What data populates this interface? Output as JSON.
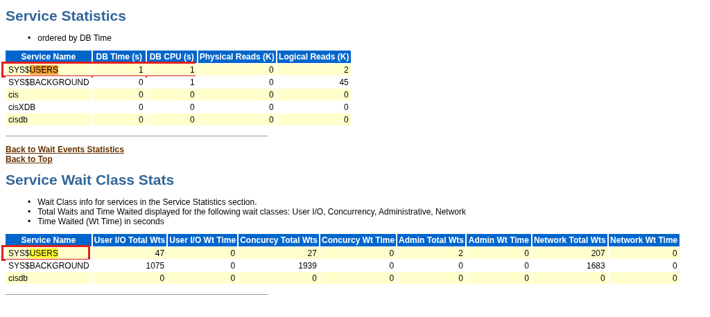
{
  "sections": [
    {
      "title": "Service Statistics",
      "notes": [
        {
          "bullet": "•",
          "text": "ordered by DB Time"
        }
      ],
      "table": {
        "columns": [
          "Service Name",
          "DB Time (s)",
          "DB CPU (s)",
          "Physical Reads (K)",
          "Logical Reads (K)"
        ],
        "rows": [
          {
            "service": {
              "prefix": "SYS$",
              "highlight": "USERS",
              "color": "#f4a131",
              "boxed": true
            },
            "values": [
              {
                "text": "1",
                "boxed": true
              },
              {
                "text": "1",
                "boxed": true
              },
              {
                "text": "0",
                "boxed": false
              },
              {
                "text": "2",
                "boxed": false
              }
            ]
          },
          {
            "service": {
              "prefix": "SYS$BACKGROUND",
              "boxed": false
            },
            "values": [
              {
                "text": "0",
                "boxed": false
              },
              {
                "text": "1",
                "boxed": false
              },
              {
                "text": "0",
                "boxed": false
              },
              {
                "text": "45",
                "boxed": false
              }
            ]
          },
          {
            "service": {
              "prefix": "cis",
              "boxed": false
            },
            "values": [
              {
                "text": "0",
                "boxed": false
              },
              {
                "text": "0",
                "boxed": false
              },
              {
                "text": "0",
                "boxed": false
              },
              {
                "text": "0",
                "boxed": false
              }
            ]
          },
          {
            "service": {
              "prefix": "cisXDB",
              "boxed": false
            },
            "values": [
              {
                "text": "0",
                "boxed": false
              },
              {
                "text": "0",
                "boxed": false
              },
              {
                "text": "0",
                "boxed": false
              },
              {
                "text": "0",
                "boxed": false
              }
            ]
          },
          {
            "service": {
              "prefix": "cisdb",
              "boxed": false
            },
            "values": [
              {
                "text": "0",
                "boxed": false
              },
              {
                "text": "0",
                "boxed": false
              },
              {
                "text": "0",
                "boxed": false
              },
              {
                "text": "0",
                "boxed": false
              }
            ]
          }
        ]
      },
      "links": [
        "Back to Wait Events Statistics",
        "Back to Top"
      ]
    },
    {
      "title": "Service Wait Class Stats",
      "notes": [
        {
          "bullet": "•",
          "text": "Wait Class info for services in the Service Statistics section."
        },
        {
          "bullet": "•",
          "text": "Total Waits and Time Waited displayed for the following wait classes: User I/O, Concurrency, Administrative, Network"
        },
        {
          "bullet": "•",
          "text": "Time Waited (Wt Time) in seconds"
        }
      ],
      "table": {
        "columns": [
          "Service Name",
          "User I/O Total Wts",
          "User I/O Wt Time",
          "Concurcy Total Wts",
          "Concurcy Wt Time",
          "Admin Total Wts",
          "Admin Wt Time",
          "Network Total Wts",
          "Network Wt Time"
        ],
        "rows": [
          {
            "service": {
              "prefix": "SYS$",
              "highlight": "USERS",
              "color": "#ffff33",
              "boxed": true
            },
            "values": [
              {
                "text": "47",
                "boxed": false
              },
              {
                "text": "0",
                "boxed": false
              },
              {
                "text": "27",
                "boxed": false
              },
              {
                "text": "0",
                "boxed": false
              },
              {
                "text": "2",
                "boxed": false
              },
              {
                "text": "0",
                "boxed": false
              },
              {
                "text": "207",
                "boxed": false
              },
              {
                "text": "0",
                "boxed": false
              }
            ]
          },
          {
            "service": {
              "prefix": "SYS$BACKGROUND",
              "boxed": false
            },
            "values": [
              {
                "text": "1075",
                "boxed": false
              },
              {
                "text": "0",
                "boxed": false
              },
              {
                "text": "1939",
                "boxed": false
              },
              {
                "text": "0",
                "boxed": false
              },
              {
                "text": "0",
                "boxed": false
              },
              {
                "text": "0",
                "boxed": false
              },
              {
                "text": "1683",
                "boxed": false
              },
              {
                "text": "0",
                "boxed": false
              }
            ]
          },
          {
            "service": {
              "prefix": "cisdb",
              "boxed": false
            },
            "values": [
              {
                "text": "0",
                "boxed": false
              },
              {
                "text": "0",
                "boxed": false
              },
              {
                "text": "0",
                "boxed": false
              },
              {
                "text": "0",
                "boxed": false
              },
              {
                "text": "0",
                "boxed": false
              },
              {
                "text": "0",
                "boxed": false
              },
              {
                "text": "0",
                "boxed": false
              },
              {
                "text": "0",
                "boxed": false
              }
            ]
          }
        ]
      }
    }
  ]
}
